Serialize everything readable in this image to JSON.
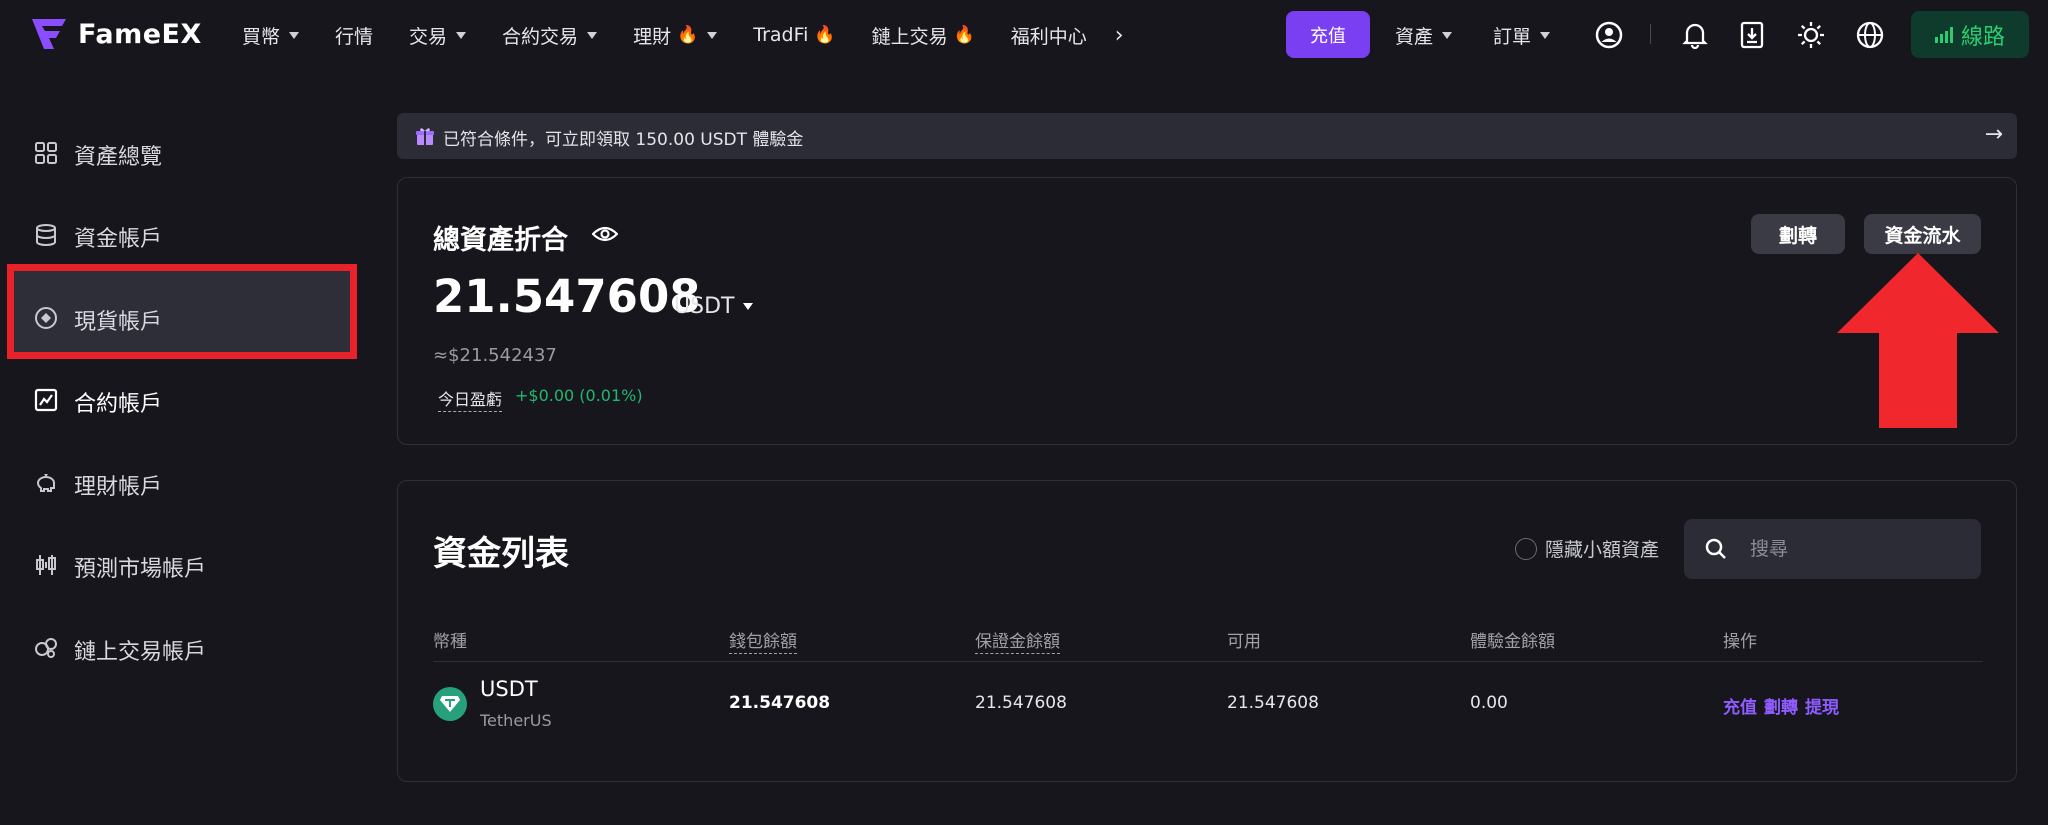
{
  "brand": {
    "name": "FameEX"
  },
  "nav": {
    "items": [
      {
        "label": "買幣",
        "caret": true,
        "fire": false
      },
      {
        "label": "行情",
        "caret": false,
        "fire": false
      },
      {
        "label": "交易",
        "caret": true,
        "fire": false
      },
      {
        "label": "合約交易",
        "caret": true,
        "fire": false
      },
      {
        "label": "理財",
        "caret": true,
        "fire": true
      },
      {
        "label": "TradFi",
        "caret": false,
        "fire": true
      },
      {
        "label": "鏈上交易",
        "caret": false,
        "fire": true
      },
      {
        "label": "福利中心",
        "caret": false,
        "fire": false
      }
    ],
    "more": "›",
    "deposit": "充值",
    "assets": "資產",
    "orders": "訂單",
    "line": "線路"
  },
  "sidebar": {
    "items": [
      {
        "label": "資產總覽",
        "icon": "grid-icon"
      },
      {
        "label": "資金帳戶",
        "icon": "database-icon"
      },
      {
        "label": "現貨帳戶",
        "icon": "target-icon"
      },
      {
        "label": "合約帳戶",
        "icon": "chart-box-icon"
      },
      {
        "label": "理財帳戶",
        "icon": "piggy-bank-icon"
      },
      {
        "label": "預測市場帳戶",
        "icon": "candlestick-icon"
      },
      {
        "label": "鏈上交易帳戶",
        "icon": "chain-icon"
      }
    ],
    "active_index": 3
  },
  "banner": {
    "text": "已符合條件，可立即領取 150.00 USDT 體驗金",
    "arrow": "→"
  },
  "summary": {
    "title": "總資產折合",
    "amount": "21.547608",
    "unit": "USDT",
    "approx": "≈$21.542437",
    "pnl_label": "今日盈虧",
    "pnl_value": "+$0.00 (0.01%)",
    "transfer_btn": "劃轉",
    "history_btn": "資金流水"
  },
  "fund_list": {
    "title": "資金列表",
    "hide_small": "隱藏小額資產",
    "search_placeholder": "搜尋",
    "headers": [
      "幣種",
      "錢包餘額",
      "保證金餘額",
      "可用",
      "體驗金餘額",
      "操作"
    ],
    "rows": [
      {
        "coin": "USDT",
        "coin_full": "TetherUS",
        "wallet_balance": "21.547608",
        "margin_balance": "21.547608",
        "available": "21.547608",
        "bonus_balance": "0.00",
        "actions": [
          "充值",
          "劃轉",
          "提現"
        ]
      }
    ]
  },
  "colors": {
    "accent": "#7b3ff2",
    "positive": "#21b86f",
    "highlight_red": "#e8212a",
    "link": "#8f5cff"
  }
}
